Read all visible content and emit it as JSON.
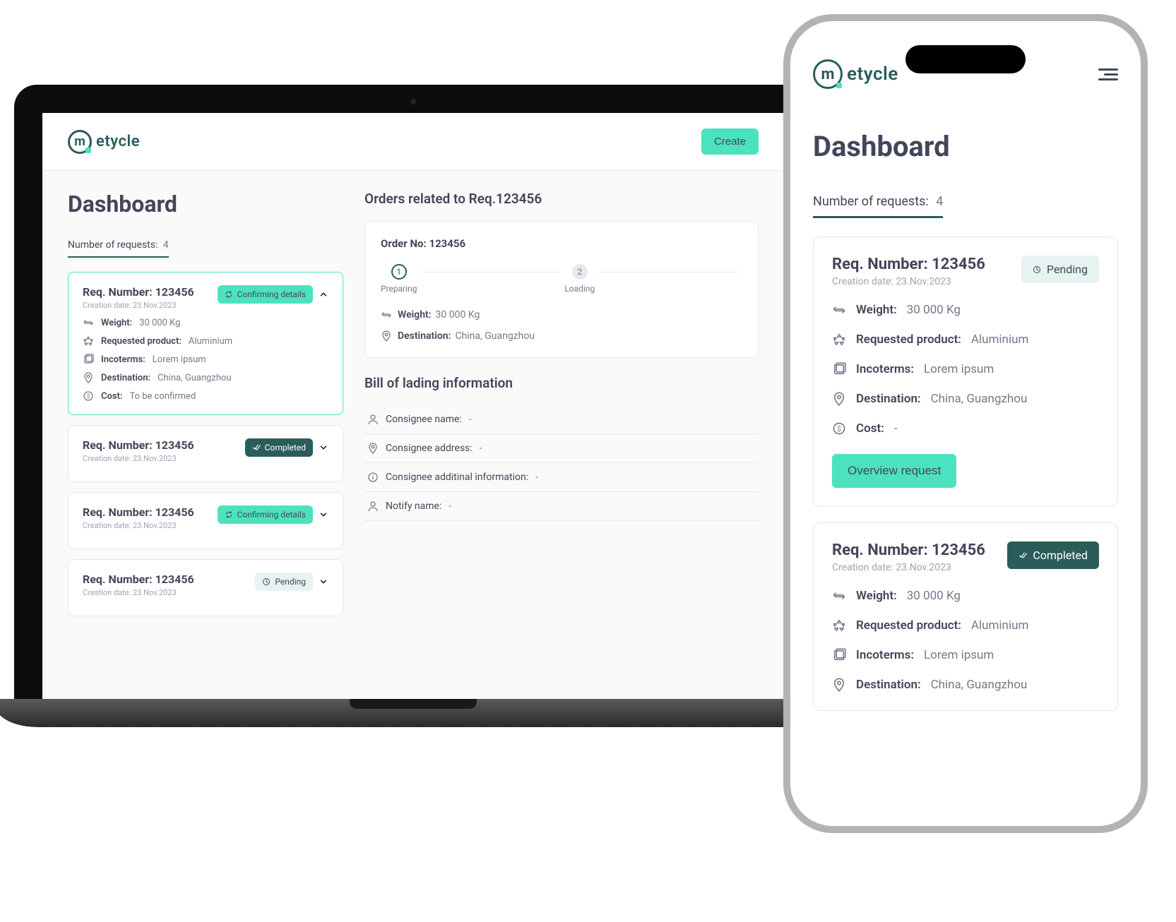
{
  "brand": {
    "mark": "m",
    "name": "etycle"
  },
  "actions": {
    "create": "Create",
    "overview": "Overview request"
  },
  "page": {
    "title": "Dashboard",
    "reqLabel": "Number of requests:",
    "reqCount": "4"
  },
  "laptop": {
    "requests": [
      {
        "num": "123456",
        "numLabel": "Req. Number: 123456",
        "date": "Creation date: 23.Nov.2023",
        "status": "Confirming details",
        "statusKind": "confirm",
        "rows": [
          {
            "icon": "swap",
            "k": "Weight:",
            "v": "30 000 Kg"
          },
          {
            "icon": "recycle",
            "k": "Requested product:",
            "v": "Aluminium"
          },
          {
            "icon": "doc",
            "k": "Incoterms:",
            "v": "Lorem ipsum"
          },
          {
            "icon": "pin",
            "k": "Destination:",
            "v": "China, Guangzhou"
          },
          {
            "icon": "cost",
            "k": "Cost:",
            "v": "To be confirmed"
          }
        ]
      },
      {
        "num": "123456",
        "numLabel": "Req. Number: 123456",
        "date": "Creation date: 23.Nov.2023",
        "status": "Completed",
        "statusKind": "completed"
      },
      {
        "num": "123456",
        "numLabel": "Req. Number: 123456",
        "date": "Creation date: 23.Nov.2023",
        "status": "Confirming details",
        "statusKind": "confirm"
      },
      {
        "num": "123456",
        "numLabel": "Req. Number: 123456",
        "date": "Creation date: 23.Nov.2023",
        "status": "Pending",
        "statusKind": "pending"
      }
    ],
    "ordersTitle": "Orders related to Req.123456",
    "order": {
      "no": "Order No: 123456",
      "steps": [
        {
          "n": "1",
          "label": "Preparing"
        },
        {
          "n": "2",
          "label": "Loading"
        }
      ],
      "weightK": "Weight:",
      "weightV": "30 000 Kg",
      "destK": "Destination:",
      "destV": "China, Guangzhou"
    },
    "blTitle": "Bill of lading information",
    "bl": [
      {
        "icon": "user",
        "k": "Consignee name:",
        "v": "-"
      },
      {
        "icon": "pin",
        "k": "Consignee address:",
        "v": "-"
      },
      {
        "icon": "info",
        "k": "Consignee additinal information:",
        "v": "-"
      },
      {
        "icon": "user",
        "k": "Notify name:",
        "v": "-"
      }
    ]
  },
  "phone": {
    "cards": [
      {
        "numLabel": "Req. Number: 123456",
        "date": "Creation date: 23.Nov.2023",
        "status": "Pending",
        "statusKind": "pending",
        "rows": [
          {
            "icon": "swap",
            "k": "Weight:",
            "v": "30 000 Kg"
          },
          {
            "icon": "recycle",
            "k": "Requested product:",
            "v": "Aluminium"
          },
          {
            "icon": "doc",
            "k": "Incoterms:",
            "v": "Lorem ipsum"
          },
          {
            "icon": "pin",
            "k": "Destination:",
            "v": "China, Guangzhou"
          },
          {
            "icon": "cost",
            "k": "Cost:",
            "v": "-"
          }
        ],
        "overview": true
      },
      {
        "numLabel": "Req. Number: 123456",
        "date": "Creation date: 23.Nov.2023",
        "status": "Completed",
        "statusKind": "completed",
        "rows": [
          {
            "icon": "swap",
            "k": "Weight:",
            "v": "30 000 Kg"
          },
          {
            "icon": "recycle",
            "k": "Requested product:",
            "v": "Aluminium"
          },
          {
            "icon": "doc",
            "k": "Incoterms:",
            "v": "Lorem ipsum"
          },
          {
            "icon": "pin",
            "k": "Destination:",
            "v": "China, Guangzhou"
          }
        ]
      }
    ]
  }
}
